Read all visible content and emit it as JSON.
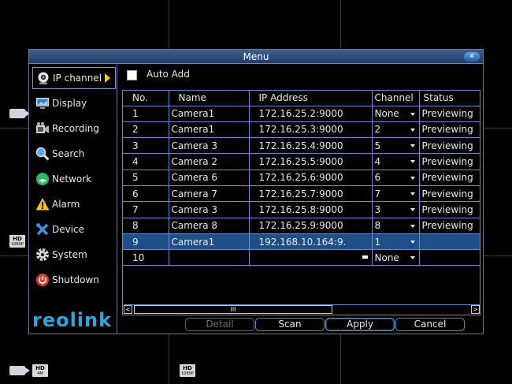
{
  "background": {
    "badges": [
      {
        "hd": "HD",
        "res": "1080P"
      },
      {
        "hd": "HD",
        "res": "4M"
      },
      {
        "hd": "HD",
        "res": "1080P"
      }
    ]
  },
  "window": {
    "title": "Menu",
    "close_glyph": "✕"
  },
  "sidebar": {
    "items": [
      {
        "label": "IP channel",
        "icon": "webcam-icon",
        "active": true
      },
      {
        "label": "Display",
        "icon": "monitor-icon"
      },
      {
        "label": "Recording",
        "icon": "film-icon"
      },
      {
        "label": "Search",
        "icon": "magnifier-icon"
      },
      {
        "label": "Network",
        "icon": "network-icon"
      },
      {
        "label": "Alarm",
        "icon": "warning-icon"
      },
      {
        "label": "Device",
        "icon": "tools-icon"
      },
      {
        "label": "System",
        "icon": "gear-icon"
      },
      {
        "label": "Shutdown",
        "icon": "power-icon"
      }
    ],
    "logo": "reolink"
  },
  "auto_add": {
    "label": "Auto Add",
    "checked": false
  },
  "table": {
    "headers": [
      "No.",
      "Name",
      "IP Address",
      "Channel",
      "Status"
    ],
    "rows": [
      {
        "no": "1",
        "name": "Camera1",
        "ip": "172.16.25.2:9000",
        "channel": "None",
        "status": "Previewing"
      },
      {
        "no": "2",
        "name": "Camera1",
        "ip": "172.16.25.3:9000",
        "channel": "2",
        "status": "Previewing"
      },
      {
        "no": "3",
        "name": "Camera 3",
        "ip": "172.16.25.4:9000",
        "channel": "5",
        "status": "Previewing"
      },
      {
        "no": "4",
        "name": "Camera 2",
        "ip": "172.16.25.5:9000",
        "channel": "4",
        "status": "Previewing"
      },
      {
        "no": "5",
        "name": "Camera 6",
        "ip": "172.16.25.6:9000",
        "channel": "6",
        "status": "Previewing"
      },
      {
        "no": "6",
        "name": "Camera 7",
        "ip": "172.16.25.7:9000",
        "channel": "7",
        "status": "Previewing"
      },
      {
        "no": "7",
        "name": "Camera 3",
        "ip": "172.16.25.8:9000",
        "channel": "3",
        "status": "Previewing"
      },
      {
        "no": "8",
        "name": "Camera 8",
        "ip": "172.16.25.9:9000",
        "channel": "8",
        "status": "Previewing"
      },
      {
        "no": "9",
        "name": "Camera1",
        "ip": "192.168.10.164:9.",
        "channel": "1",
        "status": "",
        "selected": true
      },
      {
        "no": "10",
        "name": "",
        "ip": "",
        "channel": "None",
        "status": ""
      }
    ],
    "scroll_left": "<",
    "scroll_thumb": "III",
    "scroll_right": ">"
  },
  "buttons": {
    "detail": "Detail",
    "scan": "Scan",
    "apply": "Apply",
    "cancel": "Cancel"
  },
  "colors": {
    "accent": "#1f4f88",
    "border": "#6a8fc8",
    "logo": "#29a8e0",
    "arrow": "#f0d400"
  }
}
